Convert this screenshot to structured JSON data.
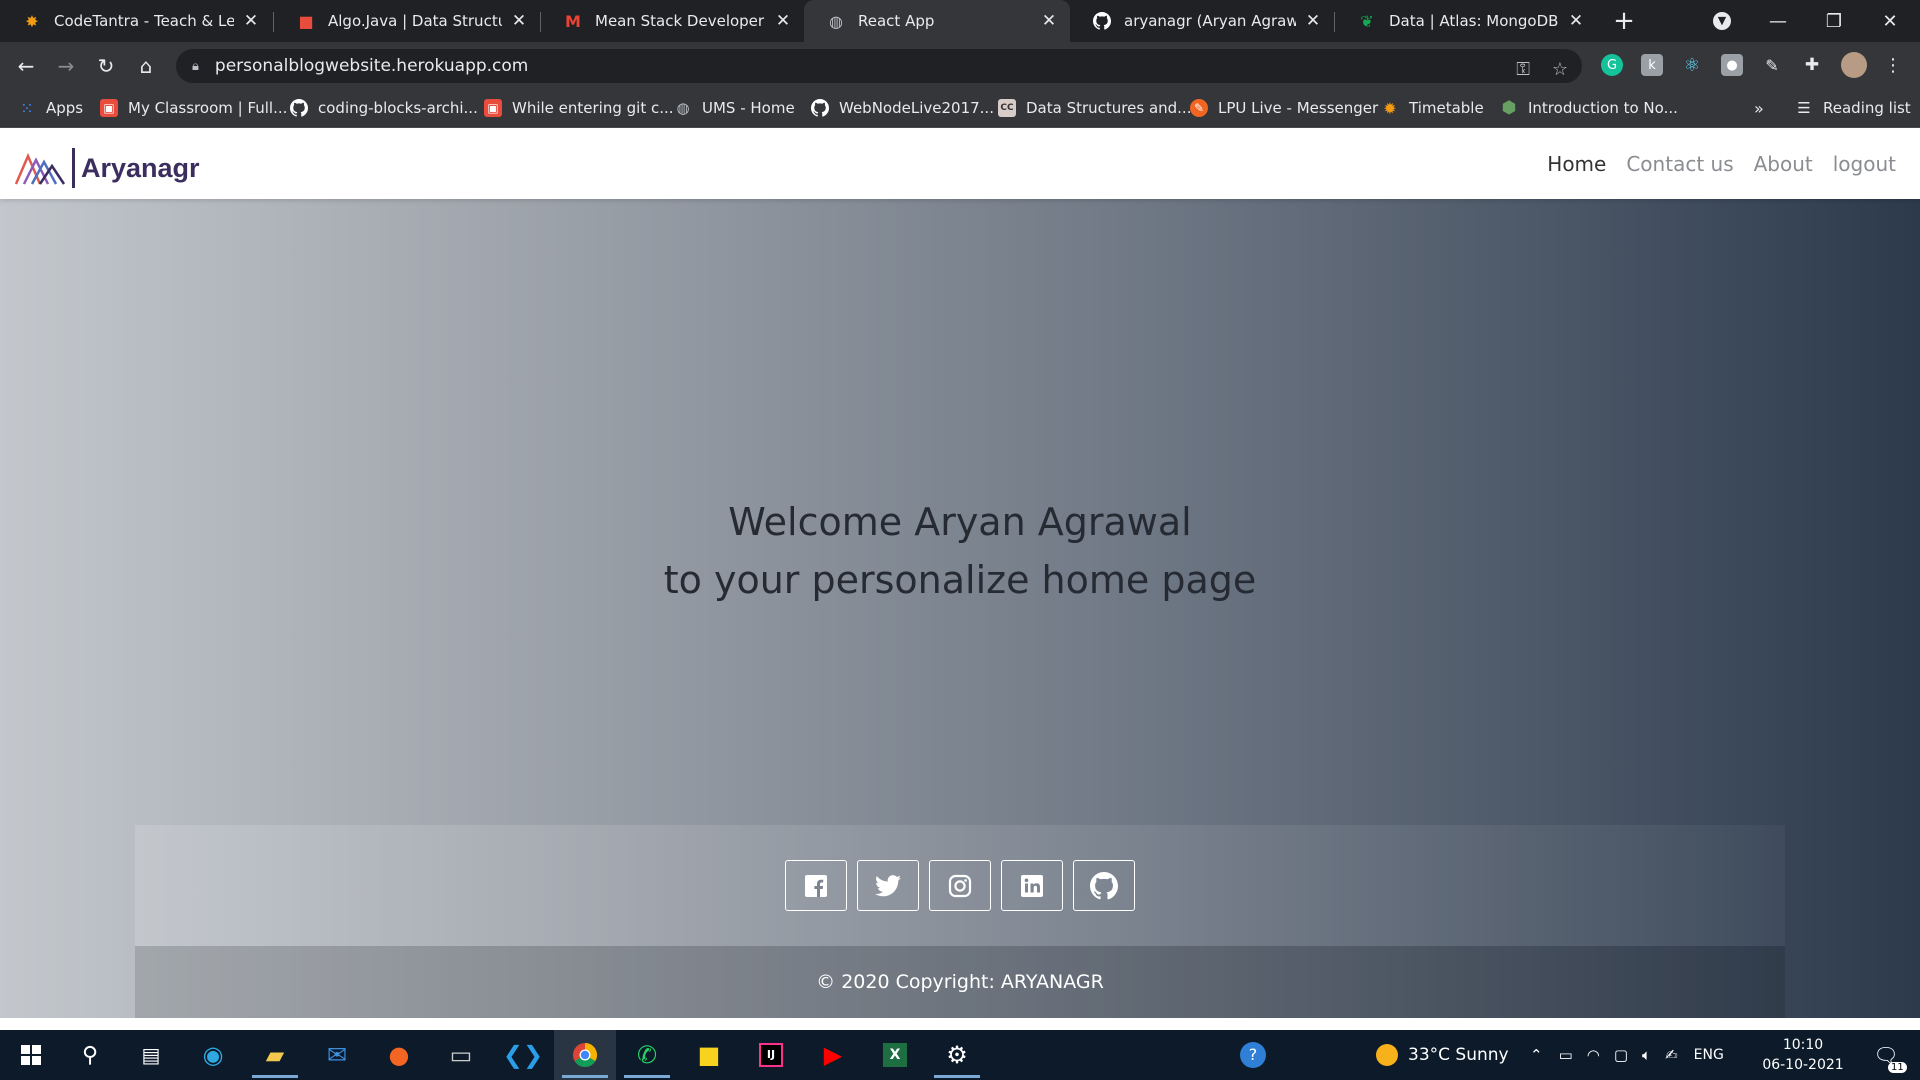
{
  "browser": {
    "tabs": [
      {
        "title": "CodeTantra - Teach & Learn",
        "icon": "codetantra-icon",
        "color": "#f39c12"
      },
      {
        "title": "Algo.Java | Data Structures a",
        "icon": "cube-icon",
        "color": "#e74c3c"
      },
      {
        "title": "Mean Stack Developer Inter",
        "icon": "gmail-icon",
        "color": "#ea4335"
      },
      {
        "title": "React App",
        "icon": "globe-icon",
        "color": "#bdc1c6"
      },
      {
        "title": "aryanagr (Aryan Agrawal)",
        "icon": "github-icon",
        "color": "#ffffff"
      },
      {
        "title": "Data | Atlas: MongoDB Atla",
        "icon": "mongodb-leaf-icon",
        "color": "#13aa52"
      }
    ],
    "url": "personalblogwebsite.herokuapp.com",
    "bookmarks": [
      {
        "label": "Apps",
        "icon": "apps-grid-icon",
        "color": "#4285f4"
      },
      {
        "label": "My Classroom | Full...",
        "icon": "cube-icon",
        "color": "#e74c3c"
      },
      {
        "label": "coding-blocks-archi...",
        "icon": "github-icon",
        "color": "#ffffff"
      },
      {
        "label": "While entering git c...",
        "icon": "cube-icon",
        "color": "#e74c3c"
      },
      {
        "label": "UMS - Home",
        "icon": "globe-icon",
        "color": "#bdc1c6"
      },
      {
        "label": "WebNodeLive2017...",
        "icon": "github-icon",
        "color": "#ffffff"
      },
      {
        "label": "Data Structures and...",
        "icon": "cc-icon",
        "color": "#d7ccc8"
      },
      {
        "label": "LPU Live - Messenger",
        "icon": "lpu-icon",
        "color": "#f26522"
      },
      {
        "label": "Timetable",
        "icon": "sun-gear-icon",
        "color": "#f39c12"
      },
      {
        "label": "Introduction to No...",
        "icon": "nodejs-icon",
        "color": "#68a063"
      }
    ],
    "reading_list": "Reading list"
  },
  "site": {
    "brand": "Aryanagr",
    "nav": [
      "Home",
      "Contact us",
      "About",
      "logout"
    ],
    "hero_line1": "Welcome Aryan Agrawal",
    "hero_line2": "to your personalize home page",
    "social": [
      "facebook-icon",
      "twitter-icon",
      "instagram-icon",
      "linkedin-icon",
      "github-icon"
    ],
    "copyright": "© 2020 Copyright: ARYANAGR"
  },
  "taskbar": {
    "weather": "33°C  Sunny",
    "lang": "ENG",
    "time": "10:10",
    "date": "06-10-2021",
    "notifications": "11"
  }
}
